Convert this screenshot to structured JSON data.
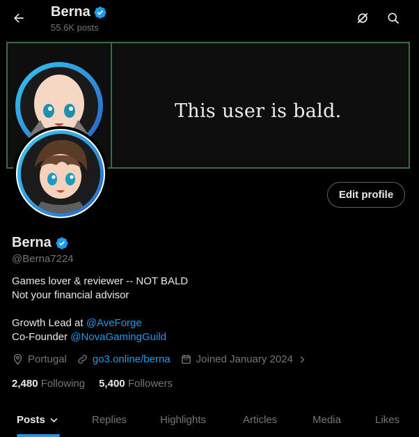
{
  "header": {
    "name": "Berna",
    "posts": "55.6K posts",
    "back_icon": "arrow-left-icon",
    "icons": [
      "grok-icon",
      "search-icon"
    ]
  },
  "banner": {
    "text": "This user is bald."
  },
  "profile": {
    "name": "Berna",
    "handle": "@Berna7224",
    "edit_label": "Edit profile",
    "bio_line1": "Games lover & reviewer -- NOT BALD",
    "bio_line2": "Not your financial advisor",
    "bio_line3_prefix": "Growth Lead at ",
    "bio_line3_link": "@AveForge",
    "bio_line4_prefix": "Co-Founder ",
    "bio_line4_link": "@NovaGamingGuild",
    "location": "Portugal",
    "website": "go3.online/berna",
    "joined": "Joined January 2024",
    "following_count": "2,480",
    "following_label": "Following",
    "followers_count": "5,400",
    "followers_label": "Followers",
    "verified_color": "#1d9bf0"
  },
  "tabs": [
    "Posts",
    "Replies",
    "Highlights",
    "Articles",
    "Media",
    "Likes"
  ],
  "colors": {
    "accent": "#1d9bf0",
    "muted": "#71767b",
    "text": "#e7e9ea",
    "banner_border": "#3f6b43"
  }
}
